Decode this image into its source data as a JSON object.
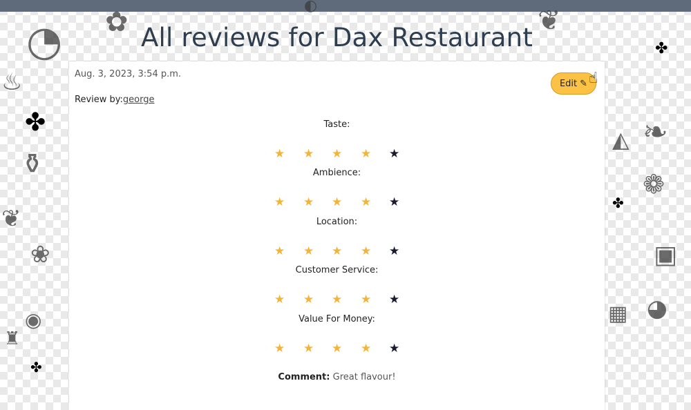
{
  "page": {
    "title": "All reviews for Dax Restaurant"
  },
  "review": {
    "date": "Aug. 3, 2023, 3:54 p.m.",
    "review_by_label": "Review by:",
    "reviewer": "george",
    "edit_label": "Edit",
    "ratings": [
      {
        "label": "Taste:",
        "stars": 4,
        "max": 5
      },
      {
        "label": "Ambience:",
        "stars": 4,
        "max": 5
      },
      {
        "label": "Location:",
        "stars": 4,
        "max": 5
      },
      {
        "label": "Customer Service:",
        "stars": 4,
        "max": 5
      },
      {
        "label": "Value For Money:",
        "stars": 4,
        "max": 5
      }
    ],
    "comment_label": "Comment:",
    "comment": "Great flavour!"
  },
  "colors": {
    "topbar": "#5f6b7a",
    "edit_button": "#fbc245",
    "star_filled": "#f2b53a",
    "star_empty": "#1a1a2e",
    "title": "#2f3e4f"
  },
  "icons": {
    "edit": "pencil-icon",
    "filled_star": "star-filled-icon",
    "empty_star": "star-empty-icon"
  }
}
